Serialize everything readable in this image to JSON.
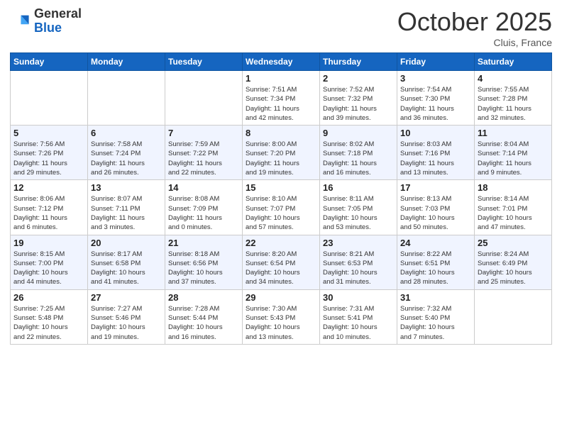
{
  "header": {
    "logo_general": "General",
    "logo_blue": "Blue",
    "month_title": "October 2025",
    "subtitle": "Cluis, France"
  },
  "weekdays": [
    "Sunday",
    "Monday",
    "Tuesday",
    "Wednesday",
    "Thursday",
    "Friday",
    "Saturday"
  ],
  "weeks": [
    [
      {
        "day": "",
        "info": ""
      },
      {
        "day": "",
        "info": ""
      },
      {
        "day": "",
        "info": ""
      },
      {
        "day": "1",
        "info": "Sunrise: 7:51 AM\nSunset: 7:34 PM\nDaylight: 11 hours\nand 42 minutes."
      },
      {
        "day": "2",
        "info": "Sunrise: 7:52 AM\nSunset: 7:32 PM\nDaylight: 11 hours\nand 39 minutes."
      },
      {
        "day": "3",
        "info": "Sunrise: 7:54 AM\nSunset: 7:30 PM\nDaylight: 11 hours\nand 36 minutes."
      },
      {
        "day": "4",
        "info": "Sunrise: 7:55 AM\nSunset: 7:28 PM\nDaylight: 11 hours\nand 32 minutes."
      }
    ],
    [
      {
        "day": "5",
        "info": "Sunrise: 7:56 AM\nSunset: 7:26 PM\nDaylight: 11 hours\nand 29 minutes."
      },
      {
        "day": "6",
        "info": "Sunrise: 7:58 AM\nSunset: 7:24 PM\nDaylight: 11 hours\nand 26 minutes."
      },
      {
        "day": "7",
        "info": "Sunrise: 7:59 AM\nSunset: 7:22 PM\nDaylight: 11 hours\nand 22 minutes."
      },
      {
        "day": "8",
        "info": "Sunrise: 8:00 AM\nSunset: 7:20 PM\nDaylight: 11 hours\nand 19 minutes."
      },
      {
        "day": "9",
        "info": "Sunrise: 8:02 AM\nSunset: 7:18 PM\nDaylight: 11 hours\nand 16 minutes."
      },
      {
        "day": "10",
        "info": "Sunrise: 8:03 AM\nSunset: 7:16 PM\nDaylight: 11 hours\nand 13 minutes."
      },
      {
        "day": "11",
        "info": "Sunrise: 8:04 AM\nSunset: 7:14 PM\nDaylight: 11 hours\nand 9 minutes."
      }
    ],
    [
      {
        "day": "12",
        "info": "Sunrise: 8:06 AM\nSunset: 7:12 PM\nDaylight: 11 hours\nand 6 minutes."
      },
      {
        "day": "13",
        "info": "Sunrise: 8:07 AM\nSunset: 7:11 PM\nDaylight: 11 hours\nand 3 minutes."
      },
      {
        "day": "14",
        "info": "Sunrise: 8:08 AM\nSunset: 7:09 PM\nDaylight: 11 hours\nand 0 minutes."
      },
      {
        "day": "15",
        "info": "Sunrise: 8:10 AM\nSunset: 7:07 PM\nDaylight: 10 hours\nand 57 minutes."
      },
      {
        "day": "16",
        "info": "Sunrise: 8:11 AM\nSunset: 7:05 PM\nDaylight: 10 hours\nand 53 minutes."
      },
      {
        "day": "17",
        "info": "Sunrise: 8:13 AM\nSunset: 7:03 PM\nDaylight: 10 hours\nand 50 minutes."
      },
      {
        "day": "18",
        "info": "Sunrise: 8:14 AM\nSunset: 7:01 PM\nDaylight: 10 hours\nand 47 minutes."
      }
    ],
    [
      {
        "day": "19",
        "info": "Sunrise: 8:15 AM\nSunset: 7:00 PM\nDaylight: 10 hours\nand 44 minutes."
      },
      {
        "day": "20",
        "info": "Sunrise: 8:17 AM\nSunset: 6:58 PM\nDaylight: 10 hours\nand 41 minutes."
      },
      {
        "day": "21",
        "info": "Sunrise: 8:18 AM\nSunset: 6:56 PM\nDaylight: 10 hours\nand 37 minutes."
      },
      {
        "day": "22",
        "info": "Sunrise: 8:20 AM\nSunset: 6:54 PM\nDaylight: 10 hours\nand 34 minutes."
      },
      {
        "day": "23",
        "info": "Sunrise: 8:21 AM\nSunset: 6:53 PM\nDaylight: 10 hours\nand 31 minutes."
      },
      {
        "day": "24",
        "info": "Sunrise: 8:22 AM\nSunset: 6:51 PM\nDaylight: 10 hours\nand 28 minutes."
      },
      {
        "day": "25",
        "info": "Sunrise: 8:24 AM\nSunset: 6:49 PM\nDaylight: 10 hours\nand 25 minutes."
      }
    ],
    [
      {
        "day": "26",
        "info": "Sunrise: 7:25 AM\nSunset: 5:48 PM\nDaylight: 10 hours\nand 22 minutes."
      },
      {
        "day": "27",
        "info": "Sunrise: 7:27 AM\nSunset: 5:46 PM\nDaylight: 10 hours\nand 19 minutes."
      },
      {
        "day": "28",
        "info": "Sunrise: 7:28 AM\nSunset: 5:44 PM\nDaylight: 10 hours\nand 16 minutes."
      },
      {
        "day": "29",
        "info": "Sunrise: 7:30 AM\nSunset: 5:43 PM\nDaylight: 10 hours\nand 13 minutes."
      },
      {
        "day": "30",
        "info": "Sunrise: 7:31 AM\nSunset: 5:41 PM\nDaylight: 10 hours\nand 10 minutes."
      },
      {
        "day": "31",
        "info": "Sunrise: 7:32 AM\nSunset: 5:40 PM\nDaylight: 10 hours\nand 7 minutes."
      },
      {
        "day": "",
        "info": ""
      }
    ]
  ]
}
